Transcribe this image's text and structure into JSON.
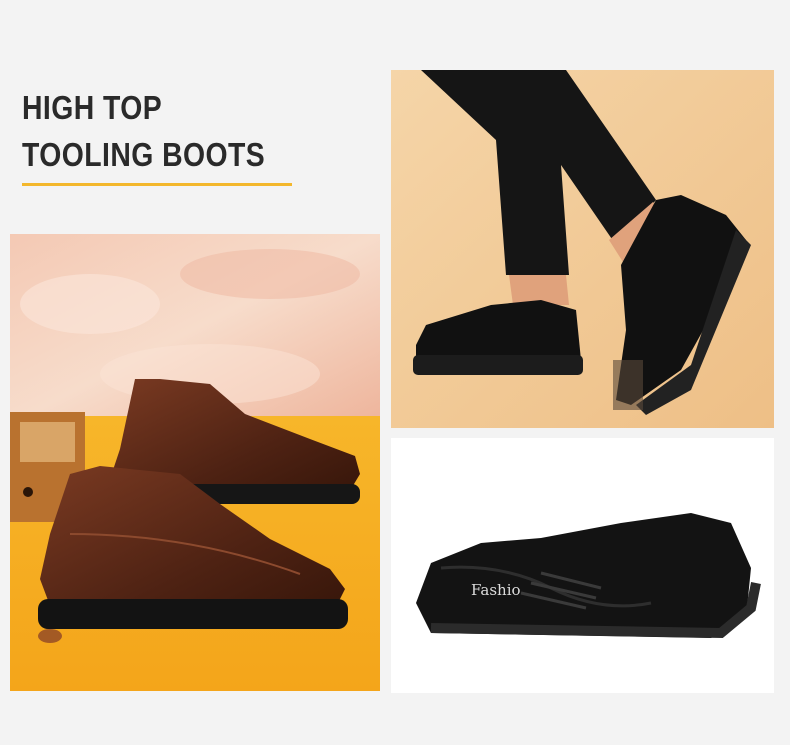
{
  "headline": {
    "line1": "HIGH TOP",
    "line2": "TOOLING BOOTS"
  },
  "colors": {
    "accent_rule": "#f3b72c",
    "page_background": "#f3f3f3",
    "panel_yellow": "#f6b120",
    "panel_peach": "#f2ce9e",
    "shoe_brown": "#5a2b1a",
    "shoe_black": "#151515"
  },
  "images": {
    "brown_pair": "brown-leather-shoes-pair",
    "worn_black": "black-shoes-worn-on-foot",
    "black_side": "black-shoe-side-view"
  },
  "shoe_insole_brand": "Fashio"
}
